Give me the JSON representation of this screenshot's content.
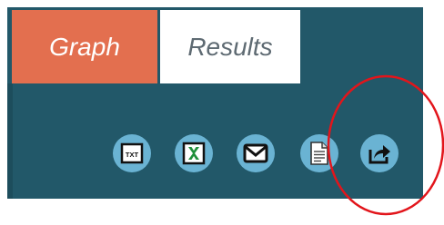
{
  "tabs": {
    "graph_label": "Graph",
    "results_label": "Results"
  },
  "toolbar": {
    "txt_label": "TXT",
    "buttons": [
      {
        "name": "txt-export",
        "icon": "txt-file-icon"
      },
      {
        "name": "excel-export",
        "icon": "excel-icon"
      },
      {
        "name": "email",
        "icon": "envelope-icon"
      },
      {
        "name": "document",
        "icon": "document-icon"
      },
      {
        "name": "share",
        "icon": "share-arrow-icon"
      }
    ]
  },
  "colors": {
    "panel": "#225869",
    "graph_tab": "#e36f4f",
    "results_tab": "#ffffff",
    "button": "#6ab3d3",
    "highlight": "#e2151b"
  }
}
